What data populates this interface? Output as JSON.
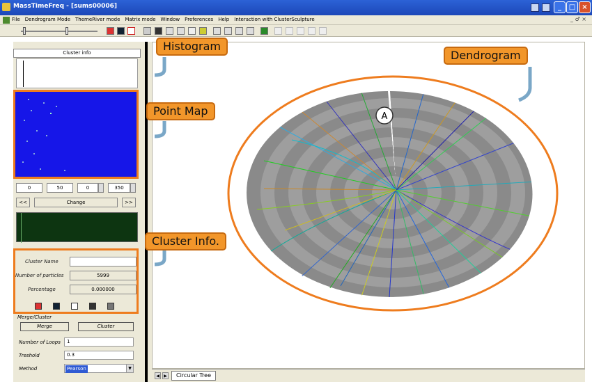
{
  "window": {
    "title": "MassTimeFreq - [sums00006]",
    "colors": {
      "titlebar": "#2c62d6",
      "chrome": "#ece9d8",
      "accent_orange": "#ee7c1e",
      "pointmap_bg": "#1616e8"
    }
  },
  "menu": {
    "items": [
      "File",
      "Dendrogram Mode",
      "ThemeRiver mode",
      "Matrix mode",
      "Window",
      "Preferences",
      "Help",
      "Interaction with ClusterSculpture"
    ],
    "mdi_controls": "_ ♂ ×"
  },
  "left_panel": {
    "header": "Cluster info",
    "range_inputs": [
      "0",
      "50",
      "0",
      "350"
    ],
    "nav": {
      "prev": "<<",
      "change": "Change",
      "next": ">>"
    },
    "cluster_info": {
      "name_label": "Cluster Name",
      "name_value": "",
      "particles_label": "Number of particles",
      "particles_value": "5999",
      "percentage_label": "Percentage",
      "percentage_value": "0.000000"
    },
    "merge_cluster": {
      "title": "Merge/Cluster",
      "merge_button": "Merge",
      "cluster_button": "Cluster",
      "loops_label": "Number of Loops",
      "loops_value": "1",
      "threshold_label": "Treshold",
      "threshold_value": "0.3",
      "method_label": "Method",
      "method_value": "Pearson"
    }
  },
  "main": {
    "tab_label": "Circular Tree",
    "marker_label": "A"
  },
  "annotations": {
    "histogram": "Histogram",
    "point_map": "Point Map",
    "cluster_info": "Cluster Info.",
    "dendrogram": "Dendrogram"
  }
}
